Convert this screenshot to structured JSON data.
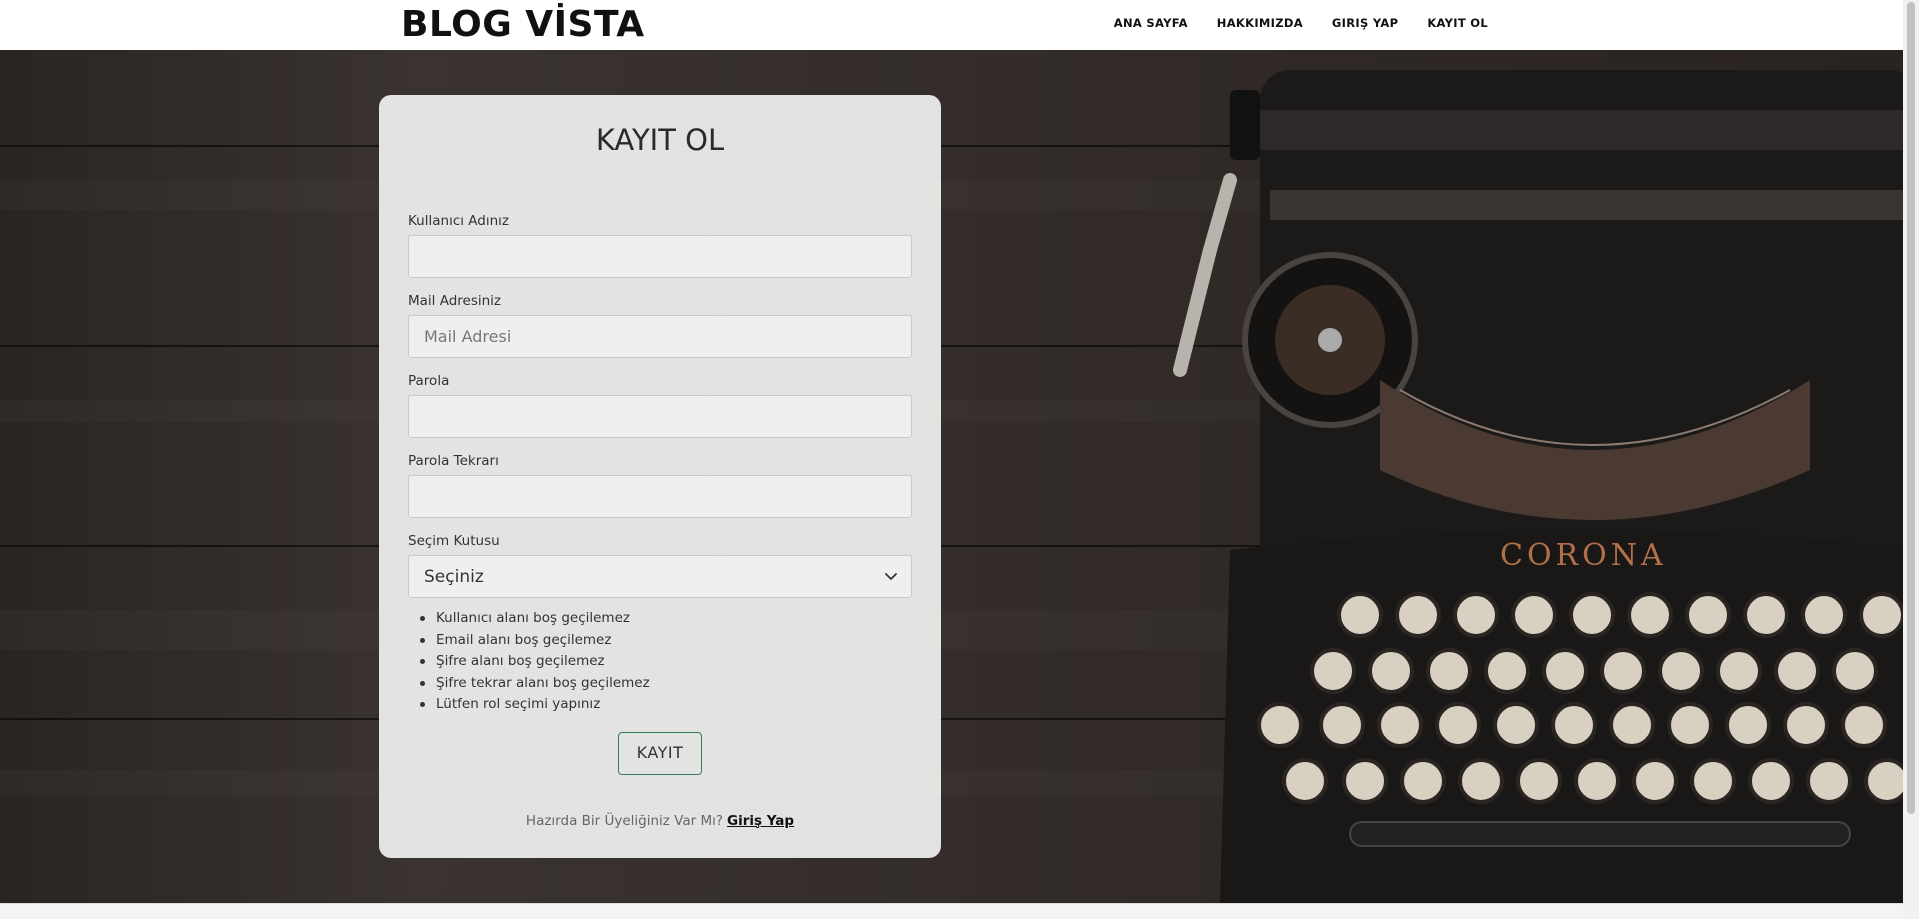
{
  "navbar": {
    "brand": "BLOG VİSTA",
    "links": [
      "ANA SAYFA",
      "HAKKIMIZDA",
      "GIRIŞ YAP",
      "KAYIT OL"
    ]
  },
  "form": {
    "title": "KAYIT OL",
    "username": {
      "label": "Kullanıcı Adınız",
      "value": "",
      "placeholder": ""
    },
    "email": {
      "label": "Mail Adresiniz",
      "value": "",
      "placeholder": "Mail Adresi"
    },
    "password": {
      "label": "Parola",
      "value": "",
      "placeholder": ""
    },
    "password_repeat": {
      "label": "Parola Tekrarı",
      "value": "",
      "placeholder": ""
    },
    "select": {
      "label": "Seçim Kutusu",
      "selected": "Seçiniz",
      "icon": "chevron-down-icon"
    },
    "errors": [
      "Kullanıcı alanı boş geçilemez",
      "Email alanı boş geçilemez",
      "Şifre alanı boş geçilemez",
      "Şifre tekrar alanı boş geçilemez",
      "Lütfen rol seçimi yapınız"
    ],
    "submit_label": "KAYIT",
    "footer_text": "Hazırda Bir Üyeliğiniz Var Mı?",
    "footer_link": "Giriş Yap"
  },
  "colors": {
    "accent_button_border": "#2e7d5b",
    "card_background": "#eeeeee",
    "hero_wood": "#352e2a"
  }
}
